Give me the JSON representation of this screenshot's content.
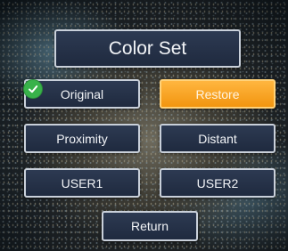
{
  "overlay": {
    "title": "Color Set"
  },
  "menu": {
    "original_label": "Original",
    "restore_label": "Restore",
    "proximity_label": "Proximity",
    "distant_label": "Distant",
    "user1_label": "USER1",
    "user2_label": "USER2",
    "return_label": "Return",
    "selected_item": "Original",
    "highlighted_item": "Restore"
  },
  "icons": {
    "selected_marker": "checkmark-icon"
  },
  "colors": {
    "button_fill": "#2d3a52",
    "button_border": "#c9d0da",
    "highlight": "#f7a21b",
    "check_green": "#38b24a"
  }
}
